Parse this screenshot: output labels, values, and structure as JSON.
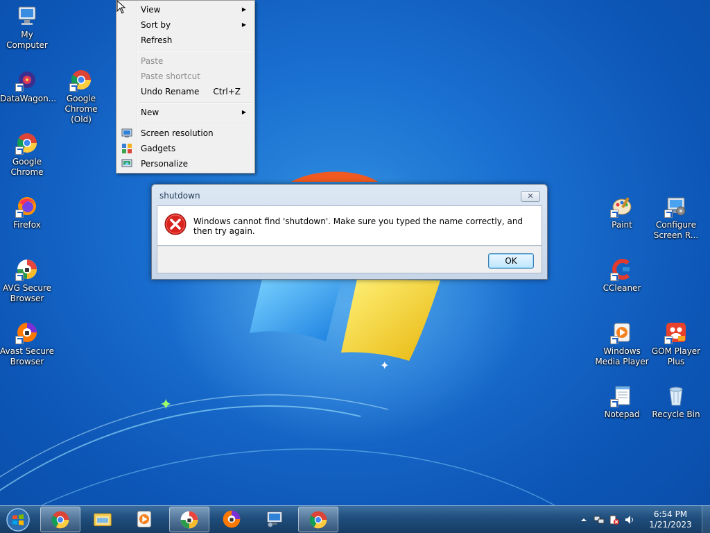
{
  "desktop_icons_left": [
    {
      "label": "My Computer",
      "icon": "computer-icon"
    },
    {
      "label": "DataWagon...",
      "icon": "datawagon-icon"
    },
    {
      "label": "Google Chrome (Old)",
      "icon": "chrome-icon"
    },
    {
      "label": "Google Chrome",
      "icon": "chrome-icon"
    },
    {
      "label": "Firefox",
      "icon": "firefox-icon"
    },
    {
      "label": "AVG Secure Browser",
      "icon": "avg-browser-icon"
    },
    {
      "label": "Avast Secure Browser",
      "icon": "avast-browser-icon"
    }
  ],
  "desktop_icons_right": [
    {
      "label": "Paint",
      "icon": "paint-icon"
    },
    {
      "label": "Configure Screen R...",
      "icon": "configure-screen-icon"
    },
    {
      "label": "CCleaner",
      "icon": "ccleaner-icon"
    },
    {
      "label": "Windows Media Player",
      "icon": "media-player-icon"
    },
    {
      "label": "GOM Player Plus",
      "icon": "gom-player-icon"
    },
    {
      "label": "Notepad",
      "icon": "notepad-icon"
    },
    {
      "label": "Recycle Bin",
      "icon": "recycle-bin-icon"
    }
  ],
  "context_menu": {
    "view": "View",
    "sort_by": "Sort by",
    "refresh": "Refresh",
    "paste": "Paste",
    "paste_shortcut": "Paste shortcut",
    "undo_rename": "Undo Rename",
    "undo_rename_shortcut": "Ctrl+Z",
    "new": "New",
    "screen_resolution": "Screen resolution",
    "gadgets": "Gadgets",
    "personalize": "Personalize"
  },
  "dialog": {
    "title": "shutdown",
    "message": "Windows cannot find 'shutdown'. Make sure you typed the name correctly, and then try again.",
    "ok_label": "OK",
    "close_glyph": "✕"
  },
  "taskbar": {
    "items": [
      {
        "name": "chrome-icon"
      },
      {
        "name": "file-explorer-icon"
      },
      {
        "name": "media-player-icon"
      },
      {
        "name": "avg-browser-icon"
      },
      {
        "name": "avast-browser-icon"
      },
      {
        "name": "remote-desktop-icon"
      },
      {
        "name": "chrome-icon"
      }
    ],
    "clock_time": "6:54 PM",
    "clock_date": "1/21/2023"
  }
}
